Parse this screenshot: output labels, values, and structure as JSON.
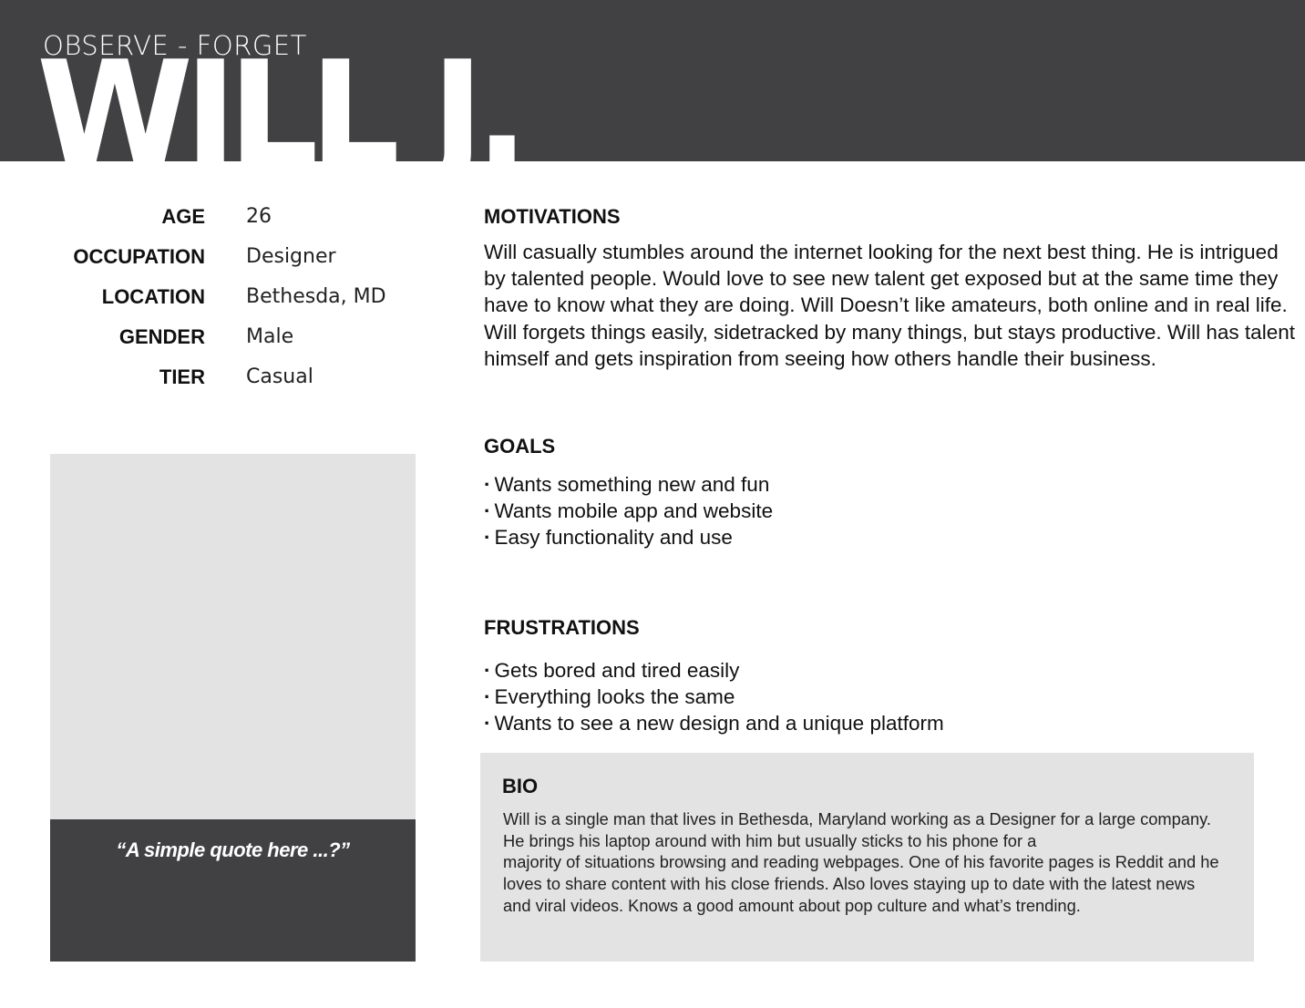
{
  "header": {
    "kicker": "OBSERVE - FORGET",
    "name": "WILL J.",
    "background_color": "#414143"
  },
  "profile": {
    "fields": [
      {
        "label": "AGE",
        "value": "26"
      },
      {
        "label": "OCCUPATION",
        "value": "Designer"
      },
      {
        "label": "LOCATION",
        "value": "Bethesda, MD"
      },
      {
        "label": "GENDER",
        "value": "Male"
      },
      {
        "label": "TIER",
        "value": "Casual"
      }
    ],
    "quote": "“A simple quote here ...?”"
  },
  "motivations": {
    "title": "MOTIVATIONS",
    "text": "Will casually stumbles around the internet looking for the next best thing. He is intrigued by talented people. Would love to see new talent get exposed but at the same time they have to know what they are doing. Will Doesn’t like amateurs, both online and in real life. Will forgets things easily, sidetracked by many things, but stays productive. Will has talent himself and gets inspiration from seeing how others handle their business."
  },
  "goals": {
    "title": "GOALS",
    "items": [
      "Wants something new and fun",
      "Wants mobile app and website",
      "Easy functionality and use"
    ]
  },
  "frustrations": {
    "title": "FRUSTRATIONS",
    "items": [
      "Gets bored and tired easily",
      "Everything looks the same",
      "Wants to see a new design and a unique platform"
    ]
  },
  "bio": {
    "title": "BIO",
    "lines": [
      "Will is a single man that lives in Bethesda, Maryland working as a Designer for a large company.",
      "He brings his laptop around with him but usually sticks to his phone for a",
      "majority of situations browsing and reading webpages. One of his favorite pages is Reddit and he",
      "loves to share content with his close friends.  Also loves staying up to date with the latest news",
      "and viral videos. Knows a good amount about pop culture and what’s trending."
    ]
  }
}
